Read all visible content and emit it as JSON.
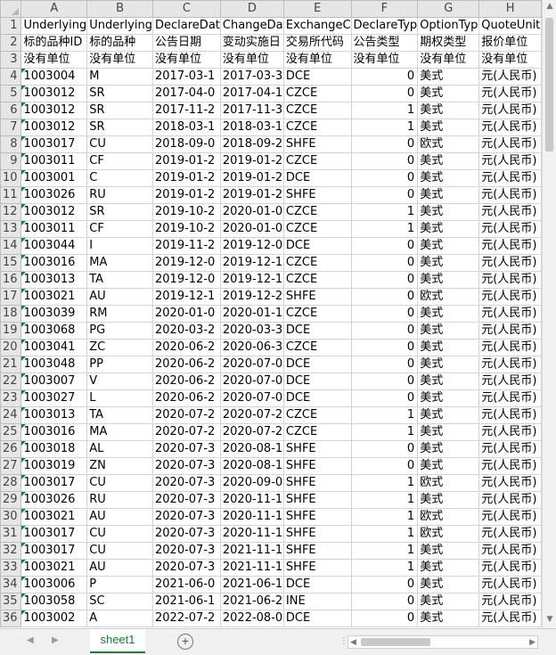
{
  "columns": [
    "A",
    "B",
    "C",
    "D",
    "E",
    "F",
    "G",
    "H"
  ],
  "rows": [
    {
      "n": "1",
      "cells": [
        "Underlying",
        "Underlying",
        "DeclareDat",
        "ChangeDa",
        "ExchangeC",
        "DeclareTyp",
        "OptionTyp",
        "QuoteUnit"
      ]
    },
    {
      "n": "2",
      "cells": [
        "标的品种ID",
        "标的品种",
        "公告日期",
        "变动实施日",
        "交易所代码",
        "公告类型",
        "期权类型",
        "报价单位"
      ]
    },
    {
      "n": "3",
      "cells": [
        "没有单位",
        "没有单位",
        "没有单位",
        "没有单位",
        "没有单位",
        "没有单位",
        "没有单位",
        "没有单位"
      ]
    },
    {
      "n": "4",
      "cells": [
        "1003004",
        "M",
        "2017-03-1",
        "2017-03-3",
        "DCE",
        "0",
        "美式",
        "元(人民币)"
      ]
    },
    {
      "n": "5",
      "cells": [
        "1003012",
        "SR",
        "2017-04-0",
        "2017-04-1",
        "CZCE",
        "0",
        "美式",
        "元(人民币)"
      ]
    },
    {
      "n": "6",
      "cells": [
        "1003012",
        "SR",
        "2017-11-2",
        "2017-11-3",
        "CZCE",
        "1",
        "美式",
        "元(人民币)"
      ]
    },
    {
      "n": "7",
      "cells": [
        "1003012",
        "SR",
        "2018-03-1",
        "2018-03-1",
        "CZCE",
        "1",
        "美式",
        "元(人民币)"
      ]
    },
    {
      "n": "8",
      "cells": [
        "1003017",
        "CU",
        "2018-09-0",
        "2018-09-2",
        "SHFE",
        "0",
        "欧式",
        "元(人民币)"
      ]
    },
    {
      "n": "9",
      "cells": [
        "1003011",
        "CF",
        "2019-01-2",
        "2019-01-2",
        "CZCE",
        "0",
        "美式",
        "元(人民币)"
      ]
    },
    {
      "n": "10",
      "cells": [
        "1003001",
        "C",
        "2019-01-2",
        "2019-01-2",
        "DCE",
        "0",
        "美式",
        "元(人民币)"
      ]
    },
    {
      "n": "11",
      "cells": [
        "1003026",
        "RU",
        "2019-01-2",
        "2019-01-2",
        "SHFE",
        "0",
        "美式",
        "元(人民币)"
      ]
    },
    {
      "n": "12",
      "cells": [
        "1003012",
        "SR",
        "2019-10-2",
        "2020-01-0",
        "CZCE",
        "1",
        "美式",
        "元(人民币)"
      ]
    },
    {
      "n": "13",
      "cells": [
        "1003011",
        "CF",
        "2019-10-2",
        "2020-01-0",
        "CZCE",
        "1",
        "美式",
        "元(人民币)"
      ]
    },
    {
      "n": "14",
      "cells": [
        "1003044",
        "I",
        "2019-11-2",
        "2019-12-0",
        "DCE",
        "0",
        "美式",
        "元(人民币)"
      ]
    },
    {
      "n": "15",
      "cells": [
        "1003016",
        "MA",
        "2019-12-0",
        "2019-12-1",
        "CZCE",
        "0",
        "美式",
        "元(人民币)"
      ]
    },
    {
      "n": "16",
      "cells": [
        "1003013",
        "TA",
        "2019-12-0",
        "2019-12-1",
        "CZCE",
        "0",
        "美式",
        "元(人民币)"
      ]
    },
    {
      "n": "17",
      "cells": [
        "1003021",
        "AU",
        "2019-12-1",
        "2019-12-2",
        "SHFE",
        "0",
        "欧式",
        "元(人民币)"
      ]
    },
    {
      "n": "18",
      "cells": [
        "1003039",
        "RM",
        "2020-01-0",
        "2020-01-1",
        "CZCE",
        "0",
        "美式",
        "元(人民币)"
      ]
    },
    {
      "n": "19",
      "cells": [
        "1003068",
        "PG",
        "2020-03-2",
        "2020-03-3",
        "DCE",
        "0",
        "美式",
        "元(人民币)"
      ]
    },
    {
      "n": "20",
      "cells": [
        "1003041",
        "ZC",
        "2020-06-2",
        "2020-06-3",
        "CZCE",
        "0",
        "美式",
        "元(人民币)"
      ]
    },
    {
      "n": "21",
      "cells": [
        "1003048",
        "PP",
        "2020-06-2",
        "2020-07-0",
        "DCE",
        "0",
        "美式",
        "元(人民币)"
      ]
    },
    {
      "n": "22",
      "cells": [
        "1003007",
        "V",
        "2020-06-2",
        "2020-07-0",
        "DCE",
        "0",
        "美式",
        "元(人民币)"
      ]
    },
    {
      "n": "23",
      "cells": [
        "1003027",
        "L",
        "2020-06-2",
        "2020-07-0",
        "DCE",
        "0",
        "美式",
        "元(人民币)"
      ]
    },
    {
      "n": "24",
      "cells": [
        "1003013",
        "TA",
        "2020-07-2",
        "2020-07-2",
        "CZCE",
        "1",
        "美式",
        "元(人民币)"
      ]
    },
    {
      "n": "25",
      "cells": [
        "1003016",
        "MA",
        "2020-07-2",
        "2020-07-2",
        "CZCE",
        "1",
        "美式",
        "元(人民币)"
      ]
    },
    {
      "n": "26",
      "cells": [
        "1003018",
        "AL",
        "2020-07-3",
        "2020-08-1",
        "SHFE",
        "0",
        "美式",
        "元(人民币)"
      ]
    },
    {
      "n": "27",
      "cells": [
        "1003019",
        "ZN",
        "2020-07-3",
        "2020-08-1",
        "SHFE",
        "0",
        "美式",
        "元(人民币)"
      ]
    },
    {
      "n": "28",
      "cells": [
        "1003017",
        "CU",
        "2020-07-3",
        "2020-09-0",
        "SHFE",
        "1",
        "欧式",
        "元(人民币)"
      ]
    },
    {
      "n": "29",
      "cells": [
        "1003026",
        "RU",
        "2020-07-3",
        "2020-11-1",
        "SHFE",
        "1",
        "美式",
        "元(人民币)"
      ]
    },
    {
      "n": "30",
      "cells": [
        "1003021",
        "AU",
        "2020-07-3",
        "2020-11-1",
        "SHFE",
        "1",
        "欧式",
        "元(人民币)"
      ]
    },
    {
      "n": "31",
      "cells": [
        "1003017",
        "CU",
        "2020-07-3",
        "2020-11-1",
        "SHFE",
        "1",
        "欧式",
        "元(人民币)"
      ]
    },
    {
      "n": "32",
      "cells": [
        "1003017",
        "CU",
        "2020-07-3",
        "2021-11-1",
        "SHFE",
        "1",
        "美式",
        "元(人民币)"
      ]
    },
    {
      "n": "33",
      "cells": [
        "1003021",
        "AU",
        "2020-07-3",
        "2021-11-1",
        "SHFE",
        "1",
        "美式",
        "元(人民币)"
      ]
    },
    {
      "n": "34",
      "cells": [
        "1003006",
        "P",
        "2021-06-0",
        "2021-06-1",
        "DCE",
        "0",
        "美式",
        "元(人民币)"
      ]
    },
    {
      "n": "35",
      "cells": [
        "1003058",
        "SC",
        "2021-06-1",
        "2021-06-2",
        "INE",
        "0",
        "美式",
        "元(人民币)"
      ]
    },
    {
      "n": "36",
      "cells": [
        "1003002",
        "A",
        "2022-07-2",
        "2022-08-0",
        "DCE",
        "0",
        "美式",
        "元(人民币)"
      ]
    }
  ],
  "sheet_tab": "sheet1",
  "add_sheet_symbol": "+",
  "accent_color": "#1e7a36",
  "icons": [
    "corner-select-all-icon",
    "scroll-up-arrow-icon",
    "scroll-down-arrow-icon",
    "scroll-left-arrow-icon",
    "scroll-right-arrow-icon",
    "prev-sheet-icon",
    "next-sheet-icon",
    "add-sheet-icon",
    "error-indicator-icon"
  ]
}
